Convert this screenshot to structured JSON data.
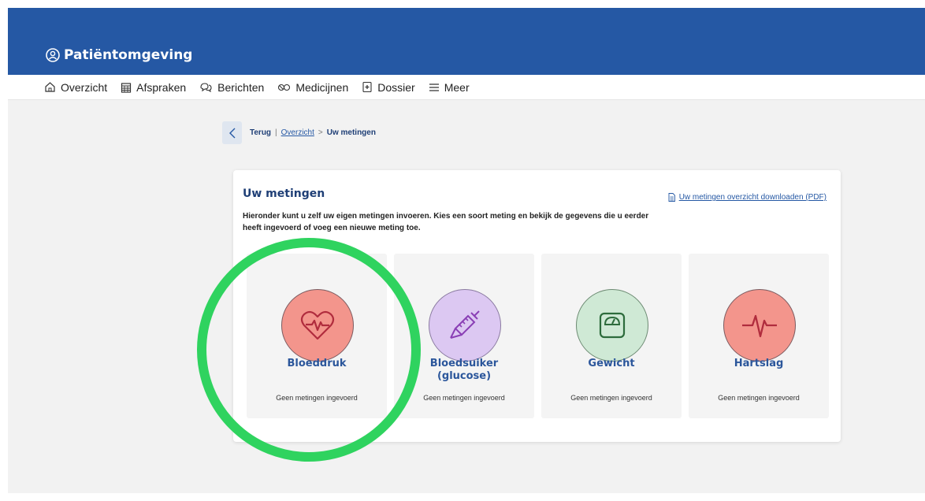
{
  "app": {
    "title": "Patiëntomgeving"
  },
  "nav": {
    "items": [
      {
        "label": "Overzicht",
        "icon": "home-icon"
      },
      {
        "label": "Afspraken",
        "icon": "calendar-icon"
      },
      {
        "label": "Berichten",
        "icon": "chat-icon"
      },
      {
        "label": "Medicijnen",
        "icon": "pills-icon"
      },
      {
        "label": "Dossier",
        "icon": "dossier-icon"
      },
      {
        "label": "Meer",
        "icon": "menu-icon"
      }
    ]
  },
  "breadcrumb": {
    "back": "Terug",
    "divider": "|",
    "parent": "Overzicht",
    "separator": ">",
    "current": "Uw metingen"
  },
  "card": {
    "title": "Uw metingen",
    "description": "Hieronder kunt u zelf uw eigen metingen invoeren. Kies een soort meting en bekijk de gegevens die u eerder heeft ingevoerd of voeg een nieuwe meting toe.",
    "pdf_link": "Uw metingen overzicht downloaden (PDF)"
  },
  "tiles": [
    {
      "name": "Bloeddruk",
      "status": "Geen metingen ingevoerd",
      "icon": "heart-pulse-icon",
      "color": "#f3958c"
    },
    {
      "name": "Bloedsuiker (glucose)",
      "status": "Geen metingen ingevoerd",
      "icon": "syringe-icon",
      "color": "#dcc8f2"
    },
    {
      "name": "Gewicht",
      "status": "Geen metingen ingevoerd",
      "icon": "scale-icon",
      "color": "#cfe9d5"
    },
    {
      "name": "Hartslag",
      "status": "Geen metingen ingevoerd",
      "icon": "heartbeat-icon",
      "color": "#f3958c"
    }
  ],
  "colors": {
    "header": "#2558a4",
    "highlight": "#2fd35f",
    "title": "#1f3f76"
  }
}
